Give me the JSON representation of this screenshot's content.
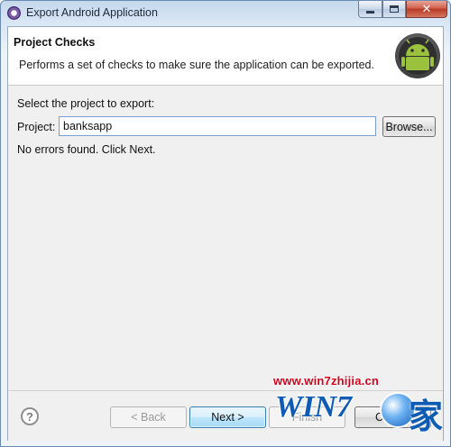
{
  "window": {
    "title": "Export Android Application",
    "close_glyph": "✕"
  },
  "banner": {
    "title": "Project Checks",
    "description": "Performs a set of checks to make sure the application can be exported."
  },
  "content": {
    "select_label": "Select the project to export:",
    "project_label": "Project:",
    "project_value": "banksapp",
    "browse_label": "Browse...",
    "status_message": "No errors found. Click Next."
  },
  "footer": {
    "help_glyph": "?",
    "back_label": "< Back",
    "next_label": "Next >",
    "finish_label": "Finish",
    "cancel_label": "Cancel"
  },
  "watermark": {
    "url": "www.win7zhijia.cn",
    "logo_text": "WIN7",
    "logo_char": "家"
  },
  "colors": {
    "accent_next": "#a7d9f5",
    "close_red": "#c8432c",
    "android_green": "#9bc23d",
    "watermark_red": "#d4001a",
    "watermark_blue": "#0d5bb5"
  },
  "icons": {
    "app_icon": "eclipse-icon",
    "banner_icon": "android-logo-icon",
    "help_icon": "help-icon"
  }
}
